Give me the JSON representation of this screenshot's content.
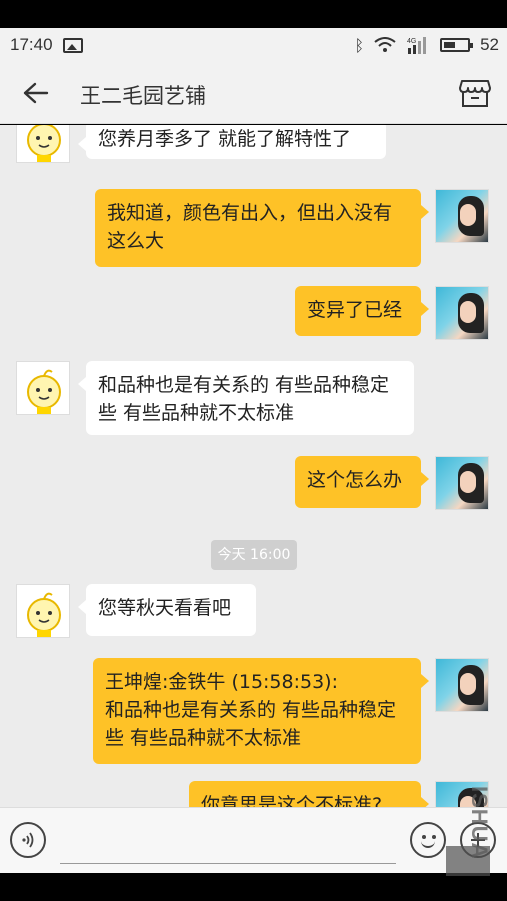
{
  "status_bar": {
    "time": "17:40",
    "network": "4G",
    "battery": "52",
    "battery_fraction": 0.52,
    "icons": [
      "gallery-icon",
      "bluetooth-icon",
      "wifi-icon",
      "signal-icon",
      "battery-icon"
    ]
  },
  "header": {
    "title": "王二毛园艺铺",
    "back_icon": "arrow-left-icon",
    "shop_icon": "shop-icon"
  },
  "messages": [
    {
      "side": "in",
      "text": "您养月季多了 就能了解特性了"
    },
    {
      "side": "out",
      "text": "我知道，颜色有出入，但出入没有这么大"
    },
    {
      "side": "out",
      "text": "变异了已经"
    },
    {
      "side": "in",
      "text": "和品种也是有关系的 有些品种稳定些 有些品种就不太标准"
    },
    {
      "side": "out",
      "text": "这个怎么办"
    },
    {
      "side": "time",
      "text": "今天 16:00"
    },
    {
      "side": "in",
      "text": "您等秋天看看吧"
    },
    {
      "side": "out",
      "text": "王坤煌:金铁牛 (15:58:53):\n和品种也是有关系的 有些品种稳定些 有些品种就不太标准"
    },
    {
      "side": "out",
      "text": "你意思是这个不标准?"
    }
  ],
  "input": {
    "value": "",
    "placeholder": ""
  },
  "watermark": "ISHUA",
  "colors": {
    "outgoing_bubble": "#fec227",
    "incoming_bubble": "#ffffff",
    "chat_background": "#ececec"
  }
}
